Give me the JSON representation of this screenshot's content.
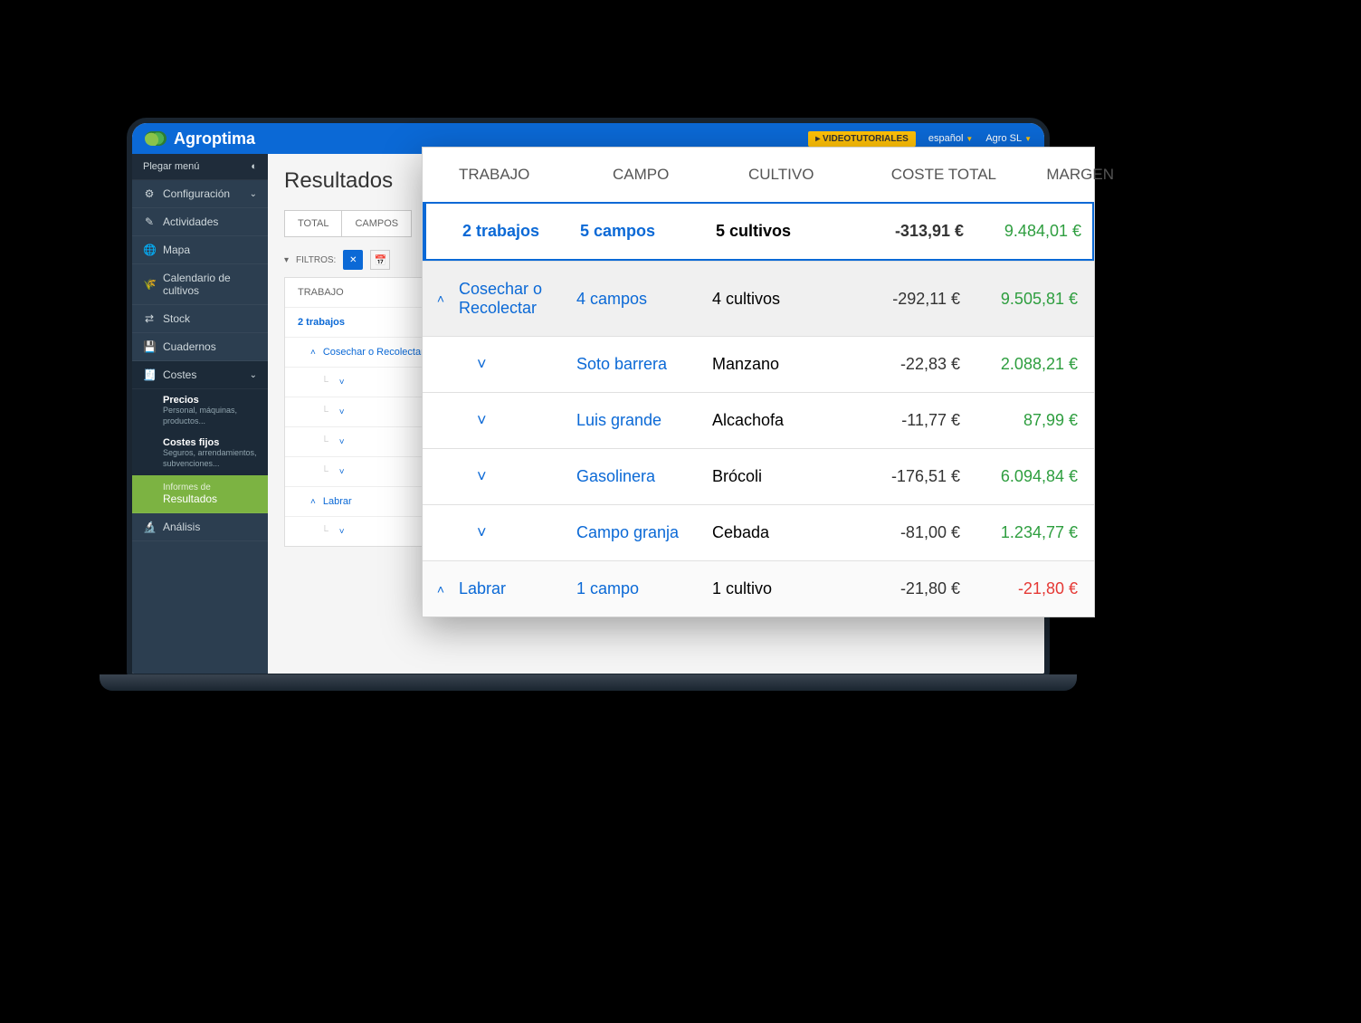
{
  "brand": "Agroptima",
  "topbar": {
    "video": "VIDEOTUTORIALES",
    "lang": "español",
    "account": "Agro SL"
  },
  "sidebar": {
    "collapse": "Plegar menú",
    "config": "Configuración",
    "activities": "Actividades",
    "map": "Mapa",
    "calendar": "Calendario de cultivos",
    "stock": "Stock",
    "cuadernos": "Cuadernos",
    "costes": "Costes",
    "precios_title": "Precios",
    "precios_desc": "Personal, máquinas, productos...",
    "fijos_title": "Costes fijos",
    "fijos_desc": "Seguros, arrendamientos, subvenciones...",
    "informes_pre": "Informes de",
    "informes_title": "Resultados",
    "analisis": "Análisis"
  },
  "main": {
    "title": "Resultados",
    "tab_total": "TOTAL",
    "tab_campos": "CAMPOS",
    "filters_label": "FILTROS:",
    "tree_header": "TRABAJO",
    "tree_summary": "2 trabajos",
    "tree_cosechar": "Cosechar o Recolectar",
    "tree_labrar": "Labrar"
  },
  "overlay": {
    "headers": {
      "trabajo": "TRABAJO",
      "campo": "CAMPO",
      "cultivo": "CULTIVO",
      "coste": "COSTE TOTAL",
      "margen": "MARGEN"
    },
    "summary": {
      "trabajo": "2 trabajos",
      "campo": "5 campos",
      "cultivo": "5 cultivos",
      "coste": "-313,91 €",
      "margen": "9.484,01 €"
    },
    "group1": {
      "trabajo": "Cosechar o Recolectar",
      "campo": "4 campos",
      "cultivo": "4 cultivos",
      "coste": "-292,11 €",
      "margen": "9.505,81 €"
    },
    "rows": [
      {
        "campo": "Soto barrera",
        "cultivo": "Manzano",
        "coste": "-22,83 €",
        "margen": "2.088,21 €"
      },
      {
        "campo": "Luis grande",
        "cultivo": "Alcachofa",
        "coste": "-11,77 €",
        "margen": "87,99 €"
      },
      {
        "campo": "Gasolinera",
        "cultivo": "Brócoli",
        "coste": "-176,51 €",
        "margen": "6.094,84 €"
      },
      {
        "campo": "Campo granja",
        "cultivo": "Cebada",
        "coste": "-81,00 €",
        "margen": "1.234,77 €"
      }
    ],
    "group2": {
      "trabajo": "Labrar",
      "campo": "1 campo",
      "cultivo": "1 cultivo",
      "coste": "-21,80 €",
      "margen": "-21,80 €"
    }
  }
}
